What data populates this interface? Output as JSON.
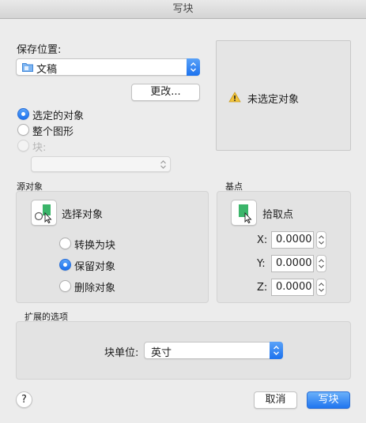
{
  "window": {
    "title": "写块"
  },
  "save_location": {
    "label": "保存位置:",
    "selected": "文稿",
    "change_button": "更改..."
  },
  "source_radios": [
    {
      "label": "选定的对象",
      "checked": true
    },
    {
      "label": "整个图形",
      "checked": false
    },
    {
      "label": "块:",
      "checked": false,
      "disabled": true
    }
  ],
  "preview": {
    "warning_text": "未选定对象"
  },
  "source_objects": {
    "title": "源对象",
    "select_label": "选择对象",
    "options": [
      {
        "label": "转换为块",
        "checked": false
      },
      {
        "label": "保留对象",
        "checked": true
      },
      {
        "label": "删除对象",
        "checked": false
      }
    ]
  },
  "base_point": {
    "title": "基点",
    "pick_label": "拾取点",
    "x_label": "X:",
    "x_value": "0.0000",
    "y_label": "Y:",
    "y_value": "0.0000",
    "z_label": "Z:",
    "z_value": "0.0000"
  },
  "extended": {
    "title": "扩展的选项",
    "unit_label": "块单位:",
    "unit_value": "英寸"
  },
  "footer": {
    "help": "?",
    "cancel": "取消",
    "ok": "写块"
  },
  "colors": {
    "accent": "#1c72ee",
    "green_icon": "#3bb56a"
  }
}
